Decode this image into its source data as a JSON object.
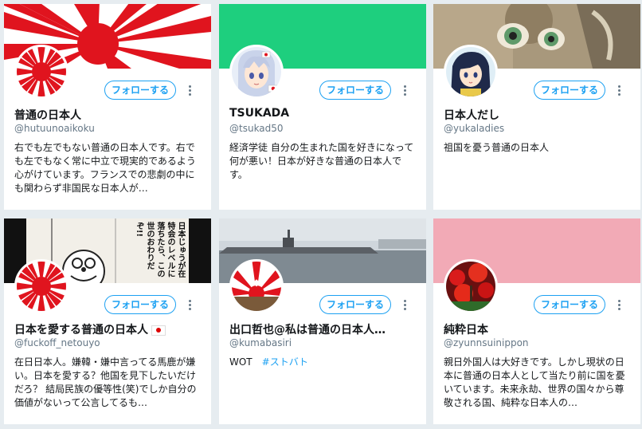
{
  "follow_label": "フォローする",
  "cards": [
    {
      "name": "普通の日本人",
      "handle": "@hutuunoaikoku",
      "bio": "右でも左でもない普通の日本人です。右でも左でもなく常に中立で現実的であるよう心がけています。フランスでの悲劇の中にも関わらず非国民な日本人が…"
    },
    {
      "name": "TSUKADA",
      "handle": "@tsukad50",
      "bio": "経済学徒 自分の生まれた国を好きになって何が悪い！日本が好きな普通の日本人です。"
    },
    {
      "name": "日本人だし",
      "handle": "@yukaladies",
      "bio": "祖国を憂う普通の日本人"
    },
    {
      "name": "日本を愛する普通の日本人",
      "handle": "@fuckoff_netouyo",
      "bio": "在日日本人。嫌韓・嫌中言ってる馬鹿が嫌い。日本を愛する？他国を見下したいだけだろ？ 結局民族の優等性(笑)でしか自分の価値がないって公言してるも…"
    },
    {
      "name": "出口哲也@私は普通の日本人…",
      "handle": "@kumabasiri",
      "bio": "WOT",
      "hashtag": "#ストバト"
    },
    {
      "name": "純粋日本",
      "handle": "@zyunnsuinippon",
      "bio": "親日外国人は大好きです。しかし現状の日本に普通の日本人として当たり前に国を憂いています。未来永劫、世界の国々から尊敬される国、純粋な日本人の…"
    }
  ],
  "banner_art": {
    "manga_text": "日本じゅうが在特会のレベルに落ちたら、この世のおわりだぞ!!"
  },
  "colors": {
    "accent": "#1da1f2",
    "green_banner": "#1ecf7e",
    "pink_banner": "#f2aab6",
    "rising_sun_red": "#e0141e"
  }
}
